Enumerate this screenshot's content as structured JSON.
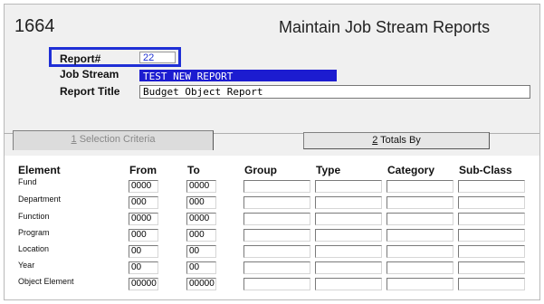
{
  "screen": {
    "id": "1664",
    "title": "Maintain Job Stream Reports"
  },
  "header": {
    "report_num_label": "Report#",
    "report_num_value": "22",
    "job_stream_label": "Job Stream",
    "job_stream_value": "TEST NEW REPORT",
    "report_title_label": "Report Title",
    "report_title_value": "Budget Object Report"
  },
  "tabs": [
    {
      "hotkey": "1",
      "label": " Selection Criteria"
    },
    {
      "hotkey": "2",
      "label": " Totals By"
    }
  ],
  "grid": {
    "columns": [
      "Element",
      "From",
      "To",
      "Group",
      "Type",
      "Category",
      "Sub-Class"
    ],
    "rows": [
      {
        "element": "Fund",
        "from": "0000",
        "to": "0000",
        "group": "",
        "type": "",
        "category": "",
        "subclass": ""
      },
      {
        "element": "Department",
        "from": "000",
        "to": "000",
        "group": "",
        "type": "",
        "category": "",
        "subclass": ""
      },
      {
        "element": "Function",
        "from": "0000",
        "to": "0000",
        "group": "",
        "type": "",
        "category": "",
        "subclass": ""
      },
      {
        "element": "Program",
        "from": "000",
        "to": "000",
        "group": "",
        "type": "",
        "category": "",
        "subclass": ""
      },
      {
        "element": "Location",
        "from": "00",
        "to": "00",
        "group": "",
        "type": "",
        "category": "",
        "subclass": ""
      },
      {
        "element": "Year",
        "from": "00",
        "to": "00",
        "group": "",
        "type": "",
        "category": "",
        "subclass": ""
      },
      {
        "element": "Object Element",
        "from": "00000",
        "to": "00000",
        "group": "",
        "type": "",
        "category": "",
        "subclass": ""
      }
    ]
  }
}
